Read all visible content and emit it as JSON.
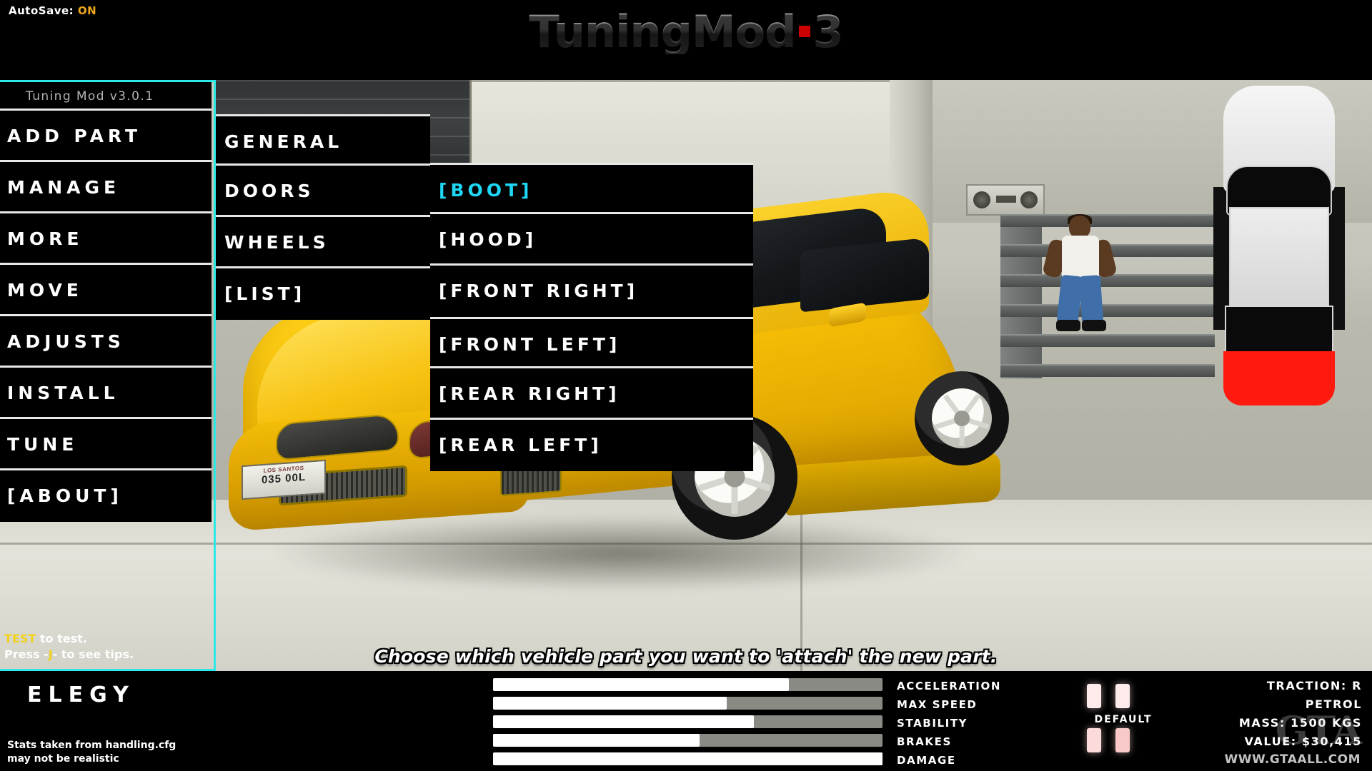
{
  "topbar": {
    "autosave_label": "AutoSave:",
    "autosave_value": "ON",
    "brand_part1": "TuningMod",
    "brand_part2": "3",
    "brand_dot_color": "#cc0000"
  },
  "sidebar": {
    "header": "Tuning Mod v3.0.1",
    "items": [
      {
        "label": "ADD PART"
      },
      {
        "label": "MANAGE"
      },
      {
        "label": "MORE"
      },
      {
        "label": "MOVE"
      },
      {
        "label": "ADJUSTS"
      },
      {
        "label": "INSTALL"
      },
      {
        "label": "TUNE"
      },
      {
        "label": "[ABOUT]"
      }
    ],
    "hint_key": "TEST",
    "hint_text": " to test.",
    "hint2_pre": "Press -",
    "hint2_key": "J",
    "hint2_post": "- to see tips."
  },
  "submenu_category": {
    "items": [
      {
        "label": "GENERAL"
      },
      {
        "label": "DOORS"
      },
      {
        "label": "WHEELS"
      },
      {
        "label": "[LIST]"
      }
    ]
  },
  "submenu_parts": {
    "selected": "[BOOT]",
    "selected_color": "#1fd7f5",
    "items_top": [
      {
        "label": "[BOOT]",
        "selected": true
      },
      {
        "label": "[HOOD]",
        "selected": false
      },
      {
        "label": "[FRONT RIGHT]",
        "selected": false
      }
    ],
    "items_bottom": [
      {
        "label": "[FRONT LEFT]",
        "selected": false
      },
      {
        "label": "[REAR RIGHT]",
        "selected": false
      },
      {
        "label": "[REAR LEFT]",
        "selected": false
      }
    ]
  },
  "help": {
    "text": "Choose which vehicle part you want to 'attach' the new part."
  },
  "hud": {
    "car_name": "ELEGY",
    "note_line1": "Stats taken from handling.cfg",
    "note_line2": "may not be realistic",
    "stats": [
      {
        "label": "ACCELERATION",
        "percent": 76
      },
      {
        "label": "MAX SPEED",
        "percent": 60
      },
      {
        "label": "STABILITY",
        "percent": 67
      },
      {
        "label": "BRAKES",
        "percent": 53
      },
      {
        "label": "DAMAGE",
        "percent": 100
      }
    ],
    "lights_label": "DEFAULT",
    "info": [
      {
        "text": "TRACTION: R"
      },
      {
        "text": "PETROL"
      },
      {
        "text": "MASS: 1500 KGS"
      },
      {
        "text": "VALUE: $30,415"
      }
    ]
  },
  "watermark": {
    "logo": "GTA",
    "url": "WWW.GTAALL.COM"
  }
}
